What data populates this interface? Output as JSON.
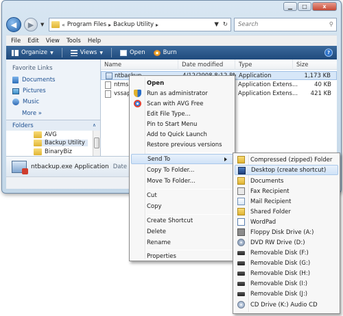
{
  "window": {
    "controls": {
      "minimize": "▁",
      "maximize": "□",
      "close": "x"
    }
  },
  "address": {
    "crumbs": [
      "Program Files",
      "Backup Utility"
    ],
    "search_placeholder": "Search"
  },
  "menubar": [
    "File",
    "Edit",
    "View",
    "Tools",
    "Help"
  ],
  "toolbar": {
    "organize": "Organize",
    "views": "Views",
    "open": "Open",
    "burn": "Burn",
    "help": "?"
  },
  "leftpane": {
    "favorite_heading": "Favorite Links",
    "favorites": [
      "Documents",
      "Pictures",
      "Music"
    ],
    "more": "More",
    "folders_heading": "Folders",
    "tree": [
      "AVG",
      "Backup Utility",
      "BinaryBiz"
    ]
  },
  "filelist": {
    "columns": [
      "Name",
      "Date modified",
      "Type",
      "Size"
    ],
    "rows": [
      {
        "name": "ntbackup.exe",
        "date": "4/12/2008 8:12 PM",
        "type": "Application",
        "size": "1,173 KB"
      },
      {
        "name": "ntmsapi.dll",
        "date": "",
        "type": "Application Extens...",
        "size": "40 KB"
      },
      {
        "name": "vssapi.dll",
        "date": "",
        "type": "Application Extens...",
        "size": "421 KB"
      }
    ]
  },
  "details": {
    "name": "ntbackup.exe Application",
    "label": "Date modified"
  },
  "context_menu": {
    "open": "Open",
    "run_admin": "Run as administrator",
    "scan_avg": "Scan with AVG Free",
    "edit_file_type": "Edit File Type...",
    "pin_start": "Pin to Start Menu",
    "quick_launch": "Add to Quick Launch",
    "restore": "Restore previous versions",
    "send_to": "Send To",
    "copy_to": "Copy To Folder...",
    "move_to": "Move To Folder...",
    "cut": "Cut",
    "copy": "Copy",
    "create_shortcut": "Create Shortcut",
    "delete": "Delete",
    "rename": "Rename",
    "properties": "Properties"
  },
  "sendto_menu": [
    {
      "label": "Compressed (zipped) Folder",
      "icon": "zip-folder-icon"
    },
    {
      "label": "Desktop (create shortcut)",
      "icon": "desktop-icon"
    },
    {
      "label": "Documents",
      "icon": "documents-folder-icon"
    },
    {
      "label": "Fax Recipient",
      "icon": "fax-icon"
    },
    {
      "label": "Mail Recipient",
      "icon": "mail-icon"
    },
    {
      "label": "Shared Folder",
      "icon": "shared-folder-icon"
    },
    {
      "label": "WordPad",
      "icon": "wordpad-icon"
    },
    {
      "label": "Floppy Disk Drive (A:)",
      "icon": "floppy-icon"
    },
    {
      "label": "DVD RW Drive (D:)",
      "icon": "dvd-icon"
    },
    {
      "label": "Removable Disk (F:)",
      "icon": "removable-disk-icon"
    },
    {
      "label": "Removable Disk (G:)",
      "icon": "removable-disk-icon"
    },
    {
      "label": "Removable Disk (H:)",
      "icon": "removable-disk-icon"
    },
    {
      "label": "Removable Disk (I:)",
      "icon": "removable-disk-icon"
    },
    {
      "label": "Removable Disk (J:)",
      "icon": "removable-disk-icon"
    },
    {
      "label": "CD Drive (K:) Audio CD",
      "icon": "cd-icon"
    }
  ]
}
